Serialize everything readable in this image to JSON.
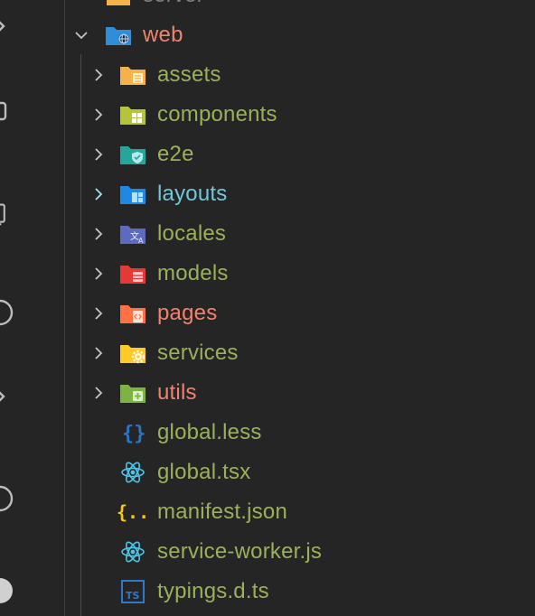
{
  "explorer": {
    "top_partial": {
      "label": "server",
      "color": "#7f7f7f"
    },
    "root": {
      "label": "web",
      "color": "#f0826e",
      "icon": "folder-web-icon",
      "expanded": true
    },
    "items": [
      {
        "label": "assets",
        "kind": "folder",
        "icon": "folder-assets-icon",
        "color": "#9bb05a"
      },
      {
        "label": "components",
        "kind": "folder",
        "icon": "folder-components-icon",
        "color": "#9bb05a"
      },
      {
        "label": "e2e",
        "kind": "folder",
        "icon": "folder-e2e-icon",
        "color": "#9bb05a"
      },
      {
        "label": "layouts",
        "kind": "folder",
        "icon": "folder-layouts-icon",
        "color": "#72c6d8"
      },
      {
        "label": "locales",
        "kind": "folder",
        "icon": "folder-locales-icon",
        "color": "#9bb05a"
      },
      {
        "label": "models",
        "kind": "folder",
        "icon": "folder-models-icon",
        "color": "#9bb05a"
      },
      {
        "label": "pages",
        "kind": "folder",
        "icon": "folder-pages-icon",
        "color": "#f0826e"
      },
      {
        "label": "services",
        "kind": "folder",
        "icon": "folder-services-icon",
        "color": "#9bb05a"
      },
      {
        "label": "utils",
        "kind": "folder",
        "icon": "folder-utils-icon",
        "color": "#f0826e"
      },
      {
        "label": "global.less",
        "kind": "file",
        "icon": "less-file-icon",
        "color": "#9bb05a"
      },
      {
        "label": "global.tsx",
        "kind": "file",
        "icon": "react-file-icon",
        "color": "#9bb05a"
      },
      {
        "label": "manifest.json",
        "kind": "file",
        "icon": "json-file-icon",
        "color": "#9bb05a"
      },
      {
        "label": "service-worker.js",
        "kind": "file",
        "icon": "react-file-icon",
        "color": "#9bb05a"
      },
      {
        "label": "typings.d.ts",
        "kind": "file",
        "icon": "typescript-file-icon",
        "color": "#9bb05a"
      }
    ]
  },
  "activity_bar": {
    "icons": [
      "chevron-right-icon",
      "square-icon",
      "device-icon",
      "circle-icon",
      "chevron-right-icon",
      "circle-icon",
      "circle-icon"
    ]
  }
}
